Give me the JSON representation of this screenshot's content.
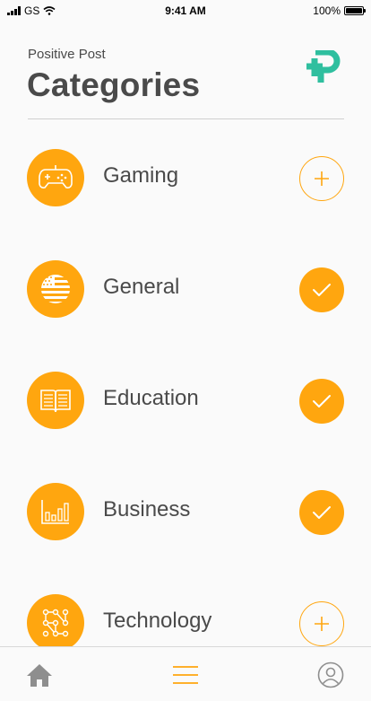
{
  "status_bar": {
    "carrier": "GS",
    "time": "9:41 AM",
    "battery": "100%"
  },
  "header": {
    "app_name": "Positive Post",
    "title": "Categories",
    "logo_icon": "positive-post-logo"
  },
  "colors": {
    "accent": "#ffa60f",
    "logo": "#2fbf9f",
    "text": "#4a4a4a"
  },
  "categories": [
    {
      "label": "Gaming",
      "icon": "gamepad-icon",
      "state": "add"
    },
    {
      "label": "General",
      "icon": "flag-icon",
      "state": "selected"
    },
    {
      "label": "Education",
      "icon": "book-icon",
      "state": "selected"
    },
    {
      "label": "Business",
      "icon": "bar-chart-icon",
      "state": "selected"
    },
    {
      "label": "Technology",
      "icon": "circuit-icon",
      "state": "add"
    }
  ],
  "tab_bar": {
    "items": [
      {
        "name": "home",
        "icon": "home-icon",
        "active": false
      },
      {
        "name": "menu",
        "icon": "menu-icon",
        "active": true
      },
      {
        "name": "profile",
        "icon": "profile-icon",
        "active": false
      }
    ]
  }
}
